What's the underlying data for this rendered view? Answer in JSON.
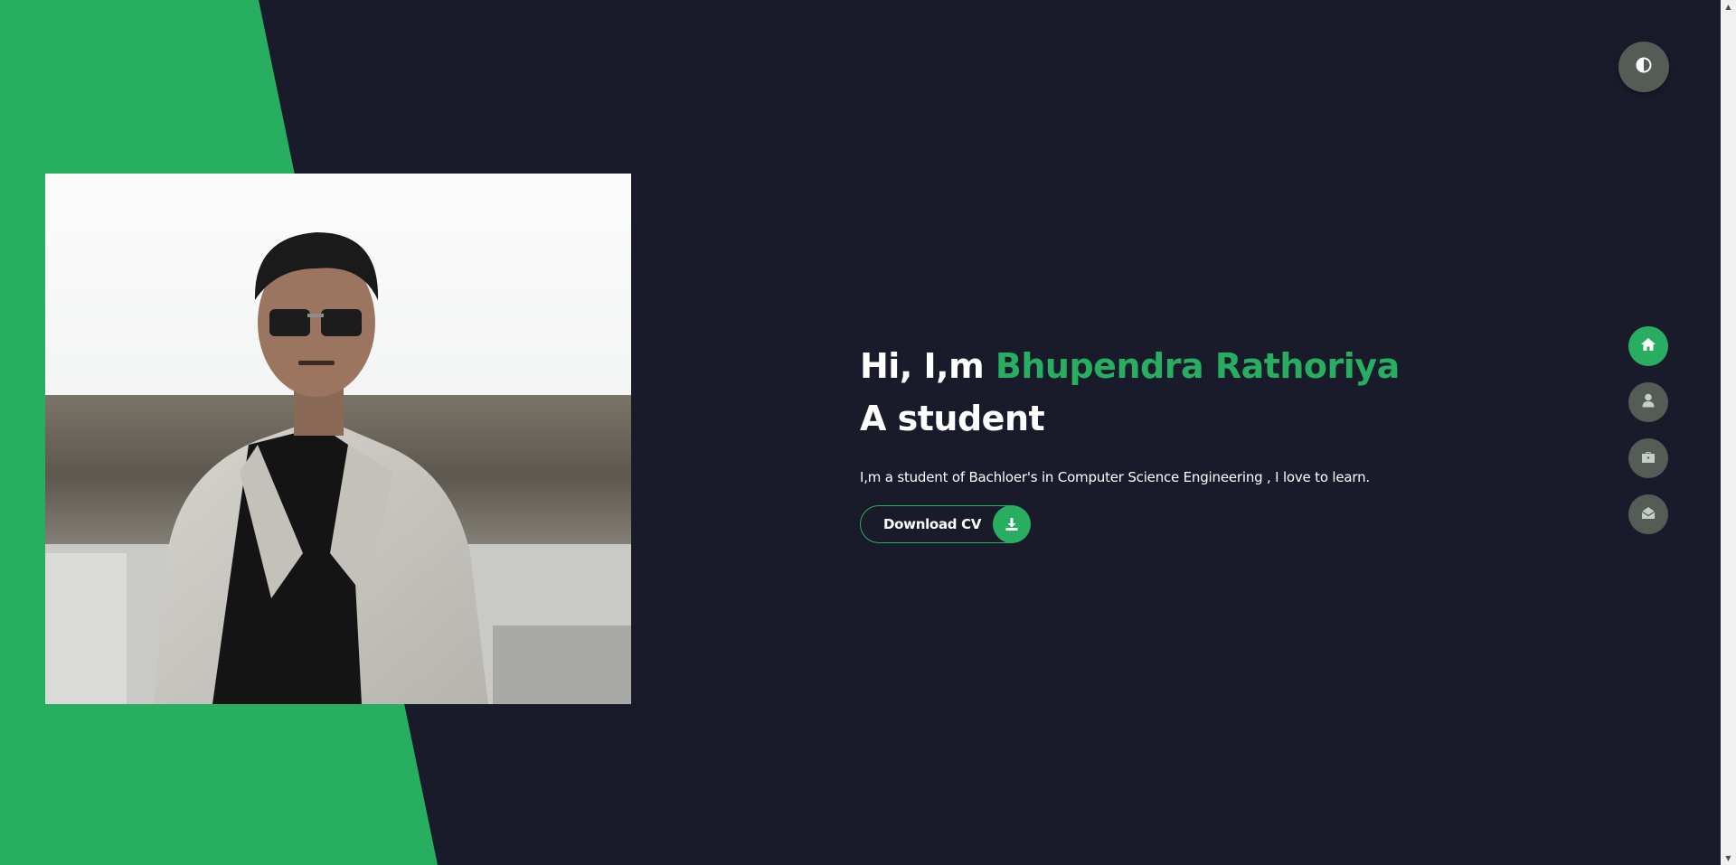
{
  "hero": {
    "title_prefix": "Hi, I,m",
    "title_name": "Bhupendra Rathoriya",
    "title_suffix": "A student",
    "description": "I,m a student of Bachloer's in Computer Science Engineering , I love to learn.",
    "download_label": "Download CV",
    "download_icon": "download-icon",
    "photo": "portrait-photo"
  },
  "theme_toggle": {
    "icon": "contrast-icon"
  },
  "side_nav": {
    "items": [
      {
        "icon": "home-icon",
        "active": true
      },
      {
        "icon": "user-icon",
        "active": false
      },
      {
        "icon": "briefcase-icon",
        "active": false
      },
      {
        "icon": "envelope-open-icon",
        "active": false
      }
    ]
  },
  "colors": {
    "background": "#191b2b",
    "accent": "#27ae60",
    "nav_inactive": "#545d55",
    "text": "#ffffff"
  }
}
